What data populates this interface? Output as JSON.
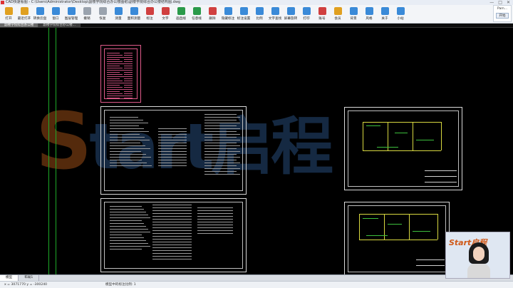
{
  "window": {
    "title": "CAD快速看图 - C:\\Users\\Administrator\\Desktop\\副楼学院综合办公楼图纸\\副楼学院综合办公楼结构图.dwg",
    "controls": [
      "—",
      "□",
      "✕"
    ]
  },
  "toolbar": [
    {
      "label": "打开",
      "icon": "open-icon",
      "color": "#e0a020"
    },
    {
      "label": "最近打开",
      "icon": "recent-icon",
      "color": "#e0a020"
    },
    {
      "label": "转换云盘",
      "icon": "cloud-icon",
      "color": "#3a8ad8"
    },
    {
      "label": "窗口",
      "icon": "window-icon",
      "color": "#3a8ad8"
    },
    {
      "label": "图层管理",
      "icon": "layers-icon",
      "color": "#3a8ad8"
    },
    {
      "label": "撤销",
      "icon": "undo-icon",
      "color": "#9aa3ae"
    },
    {
      "label": "恢复",
      "icon": "redo-icon",
      "color": "#9aa3ae"
    },
    {
      "label": "测量",
      "icon": "measure-icon",
      "color": "#3a8ad8"
    },
    {
      "label": "面积测量",
      "icon": "area-icon",
      "color": "#3a8ad8"
    },
    {
      "label": "标注",
      "icon": "annotate-icon",
      "color": "#d04040"
    },
    {
      "label": "文字",
      "icon": "text-icon",
      "color": "#d04040"
    },
    {
      "label": "画直线",
      "icon": "line-icon",
      "color": "#2a9a4a"
    },
    {
      "label": "任意线",
      "icon": "freehand-icon",
      "color": "#2a9a4a"
    },
    {
      "label": "删除",
      "icon": "delete-icon",
      "color": "#d04040"
    },
    {
      "label": "隐藏标注",
      "icon": "hide-icon",
      "color": "#3a8ad8"
    },
    {
      "label": "标注设置",
      "icon": "settings-icon",
      "color": "#3a8ad8"
    },
    {
      "label": "比例",
      "icon": "scale-icon",
      "color": "#3a8ad8"
    },
    {
      "label": "文字查找",
      "icon": "find-icon",
      "color": "#3a8ad8"
    },
    {
      "label": "屏幕旋转",
      "icon": "rotate-icon",
      "color": "#3a8ad8"
    },
    {
      "label": "打印",
      "icon": "print-icon",
      "color": "#3a8ad8"
    },
    {
      "label": "账号",
      "icon": "account-icon",
      "color": "#d04040"
    },
    {
      "label": "会员",
      "icon": "vip-icon",
      "color": "#e0a020"
    },
    {
      "label": "背景",
      "icon": "background-icon",
      "color": "#3a8ad8"
    },
    {
      "label": "风格",
      "icon": "style-icon",
      "color": "#3a8ad8"
    },
    {
      "label": "关于",
      "icon": "about-icon",
      "color": "#3a8ad8"
    },
    {
      "label": "小站",
      "icon": "site-icon",
      "color": "#3a8ad8"
    }
  ],
  "side_panel": {
    "title": "Pam...",
    "button": "开始"
  },
  "doc_tabs": [
    {
      "label": "副楼学院综合办公楼",
      "active": true
    },
    {
      "label": "副楼学院综合办公楼...",
      "active": false
    }
  ],
  "watermark": {
    "s": "S",
    "rest": "tart启程"
  },
  "layout_tabs": [
    {
      "label": "模型",
      "active": true
    },
    {
      "label": "布局1",
      "active": false
    }
  ],
  "status": {
    "coords": "x = 3071770  y = -300240",
    "hint": "模型中的标注比例: 1"
  },
  "video": {
    "logo": "Start启程"
  }
}
